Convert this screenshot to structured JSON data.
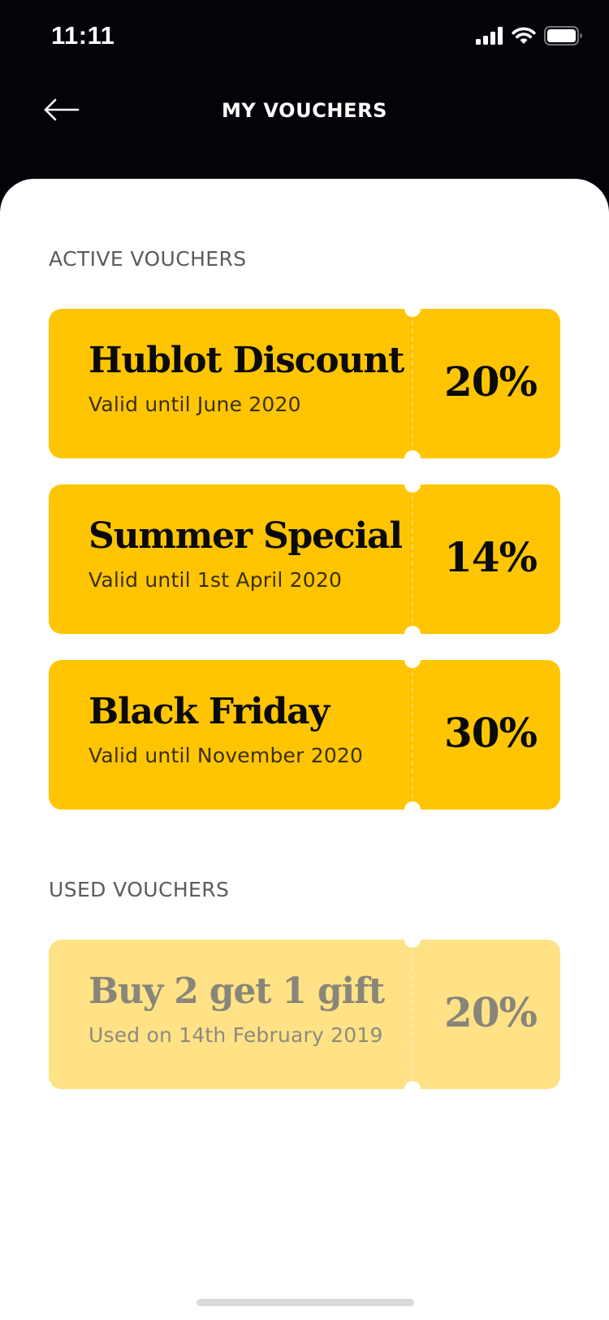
{
  "status_bar": {
    "time": "11:11"
  },
  "nav": {
    "back_icon": "arrow-left-icon",
    "title": "MY VOUCHERS"
  },
  "sections": {
    "active_label": "ACTIVE VOUCHERS",
    "used_label": "USED VOUCHERS"
  },
  "active_vouchers": [
    {
      "title": "Hublot Discount",
      "subtitle": "Valid until June 2020",
      "percent": "20%"
    },
    {
      "title": "Summer Special",
      "subtitle": "Valid until 1st April 2020",
      "percent": "14%"
    },
    {
      "title": "Black Friday",
      "subtitle": "Valid until November 2020",
      "percent": "30%"
    }
  ],
  "used_vouchers": [
    {
      "title": "Buy 2 get 1 gift",
      "subtitle": "Used on 14th February 2019",
      "percent": "20%"
    }
  ],
  "colors": {
    "header_background": "#03040a",
    "voucher_active": "#ffc502",
    "voucher_used": "#fee285",
    "sheet_background": "#ffffff"
  }
}
